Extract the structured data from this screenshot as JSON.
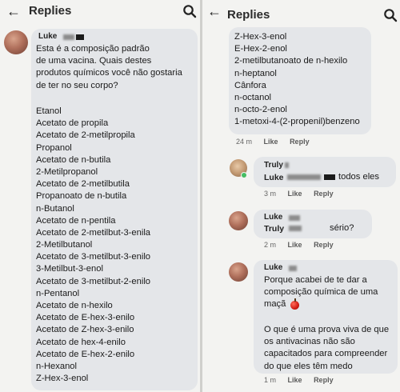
{
  "left": {
    "header": {
      "title": "Replies"
    },
    "comment": {
      "author": "Luke",
      "question": [
        "Esta é a composição padrão",
        "de uma vacina. Quais destes",
        "produtos químicos você não gostaria",
        "de ter no seu corpo?"
      ],
      "chemicals": [
        "Etanol",
        "Acetato de propila",
        "Acetato de 2-metilpropila",
        "Propanol",
        "Acetato de n-butila",
        "2-Metilpropanol",
        "Acetato de 2-metilbutila",
        "Propanoato de n-butila",
        "n-Butanol",
        "Acetato de n-pentila",
        "Acetato de 2-metilbut-3-enila",
        "2-Metilbutanol",
        "Acetato de 3-metilbut-3-enilo",
        "3-Metilbut-3-enol",
        "Acetato de 3-metilbut-2-enilo",
        "n-Pentanol",
        "Acetato de n-hexilo",
        "Acetato de E-hex-3-enilo",
        "Acetato de Z-hex-3-enilo",
        "Acetato de hex-4-enilo",
        "Acetato de E-hex-2-enilo",
        "n-Hexanol",
        "Z-Hex-3-enol"
      ]
    }
  },
  "right": {
    "header": {
      "title": "Replies"
    },
    "continued": [
      "Z-Hex-3-enol",
      "E-Hex-2-enol",
      "2-metilbutanoato de n-hexilo",
      "n-heptanol",
      "Cânfora",
      "n-octanol",
      "n-octo-2-enol",
      "1-metoxi-4-(2-propenil)benzeno"
    ],
    "continued_meta": {
      "time": "24 m",
      "like": "Like",
      "reply": "Reply"
    },
    "reply1": {
      "author": "Truly",
      "mention": "Luke",
      "text": "todos eles",
      "time": "3 m",
      "like": "Like",
      "reply": "Reply"
    },
    "reply2": {
      "author": "Luke",
      "mention": "Truly",
      "text": "sério?",
      "time": "2 m",
      "like": "Like",
      "reply": "Reply"
    },
    "reply3": {
      "author": "Luke",
      "lines": [
        "Porque acabei de te dar a",
        "composição química de uma",
        "maçã"
      ],
      "lines2": [
        "O que é uma prova viva de que",
        "os antivacinas não são",
        "capacitados para compreender",
        "do que eles têm medo"
      ],
      "time": "1 m",
      "like": "Like",
      "reply": "Reply"
    }
  }
}
